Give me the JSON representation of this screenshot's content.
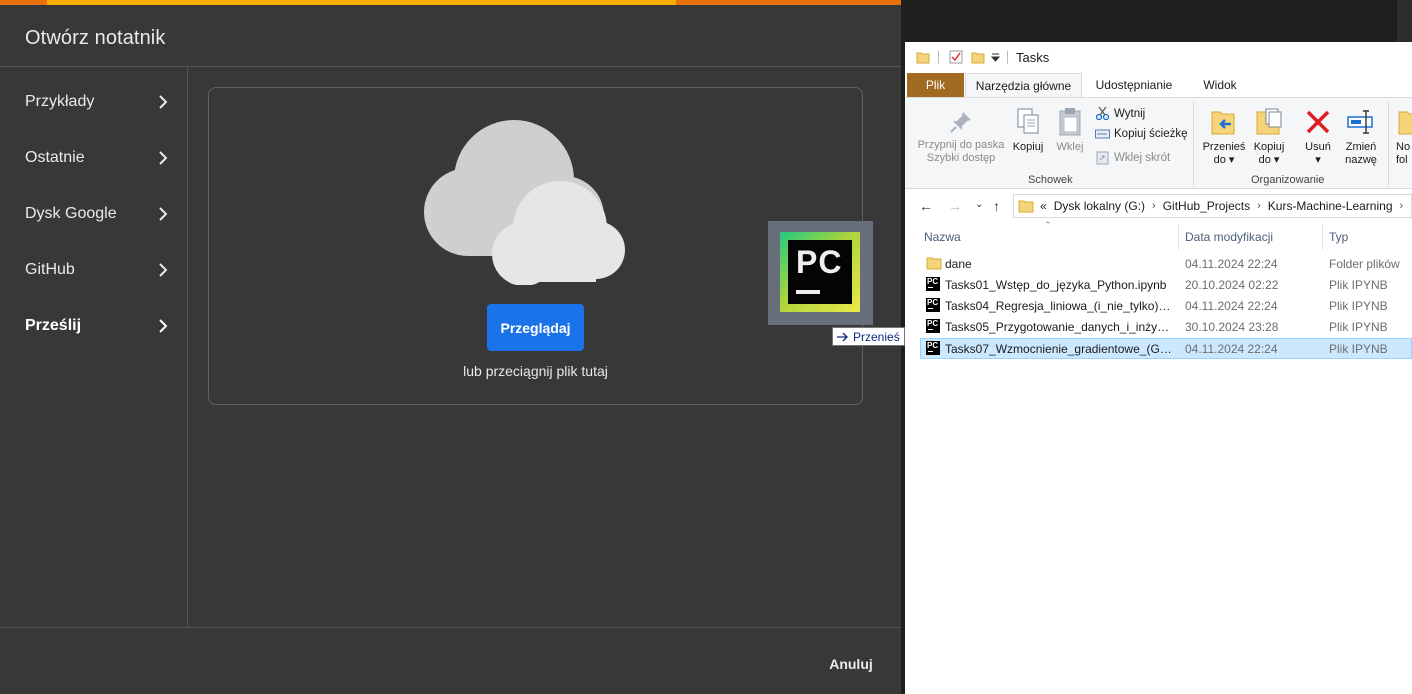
{
  "colab": {
    "title": "Otwórz notatnik",
    "progress_fraction": 0.75,
    "nav": [
      {
        "label": "Przykłady"
      },
      {
        "label": "Ostatnie"
      },
      {
        "label": "Dysk Google"
      },
      {
        "label": "GitHub"
      },
      {
        "label": "Prześlij"
      }
    ],
    "active_nav": "Prześlij",
    "upload": {
      "browse_label": "Przeglądaj",
      "hint": "lub przeciągnij plik tutaj"
    },
    "cancel_label": "Anuluj",
    "colors": {
      "accent": "#1a73e8",
      "progress": "#f9ab00",
      "background": "#383838"
    }
  },
  "drag": {
    "icon_text": "PC",
    "tooltip": "Przenieś"
  },
  "explorer": {
    "window_title": "Tasks",
    "tabs": {
      "file": "Plik",
      "home": "Narzędzia główne",
      "share": "Udostępnianie",
      "view": "Widok"
    },
    "ribbon": {
      "pin_line1": "Przypnij do paska",
      "pin_line2": "Szybki dostęp",
      "copy": "Kopiuj",
      "paste": "Wklej",
      "cut": "Wytnij",
      "copy_path": "Kopiuj ścieżkę",
      "paste_shortcut": "Wklej skrót",
      "clipboard_group": "Schowek",
      "move_to_line1": "Przenieś",
      "move_to_line2": "do",
      "copy_to_line1": "Kopiuj",
      "copy_to_line2": "do",
      "delete": "Usuń",
      "rename_line1": "Zmień",
      "rename_line2": "nazwę",
      "organize_group": "Organizowanie",
      "new_folder_partial_1": "No",
      "new_folder_partial_2": "fol"
    },
    "address": {
      "overflow": "«",
      "crumbs": [
        "Dysk lokalny (G:)",
        "GitHub_Projects",
        "Kurs-Machine-Learning"
      ]
    },
    "columns": {
      "name": "Nazwa",
      "date": "Data modyfikacji",
      "type": "Typ"
    },
    "files": [
      {
        "name": "dane",
        "date": "04.11.2024 22:24",
        "type": "Folder plików",
        "icon": "folder-icon",
        "selected": false
      },
      {
        "name": "Tasks01_Wstęp_do_języka_Python.ipynb",
        "date": "20.10.2024 02:22",
        "type": "Plik IPYNB",
        "icon": "pycharm-file-icon",
        "selected": false
      },
      {
        "name": "Tasks04_Regresja_liniowa_(i_nie_tylko).ip...",
        "date": "04.11.2024 22:24",
        "type": "Plik IPYNB",
        "icon": "pycharm-file-icon",
        "selected": false
      },
      {
        "name": "Tasks05_Przygotowanie_danych_i_inżynie...",
        "date": "30.10.2024 23:28",
        "type": "Plik IPYNB",
        "icon": "pycharm-file-icon",
        "selected": false
      },
      {
        "name": "Tasks07_Wzmocnienie_gradientowe_(Gra...",
        "date": "04.11.2024 22:24",
        "type": "Plik IPYNB",
        "icon": "pycharm-file-icon",
        "selected": true
      }
    ]
  }
}
